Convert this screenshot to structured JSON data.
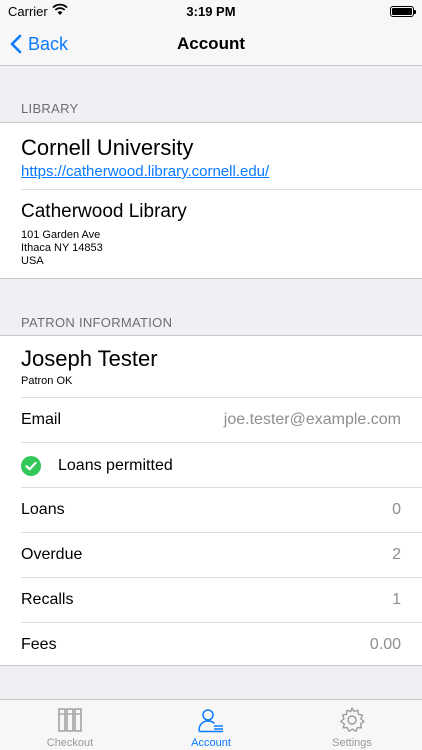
{
  "status": {
    "carrier": "Carrier",
    "time": "3:19 PM"
  },
  "nav": {
    "back_label": "Back",
    "title": "Account"
  },
  "library_section": {
    "header": "LIBRARY",
    "name": "Cornell University",
    "url": "https://catherwood.library.cornell.edu/",
    "branch": "Catherwood Library",
    "address": [
      "101 Garden Ave",
      "Ithaca NY 14853",
      "USA"
    ]
  },
  "patron_section": {
    "header": "PATRON INFORMATION",
    "name": "Joseph Tester",
    "status": "Patron OK",
    "email_label": "Email",
    "email_value": "joe.tester@example.com",
    "loans_permitted": "Loans permitted",
    "rows": [
      {
        "label": "Loans",
        "value": "0"
      },
      {
        "label": "Overdue",
        "value": "2"
      },
      {
        "label": "Recalls",
        "value": "1"
      },
      {
        "label": "Fees",
        "value": "0.00"
      }
    ]
  },
  "tabs": [
    {
      "label": "Checkout",
      "icon": "books-icon",
      "active": false
    },
    {
      "label": "Account",
      "icon": "person-list-icon",
      "active": true
    },
    {
      "label": "Settings",
      "icon": "gear-icon",
      "active": false
    }
  ],
  "colors": {
    "accent": "#0a7aff",
    "success": "#34c759"
  }
}
